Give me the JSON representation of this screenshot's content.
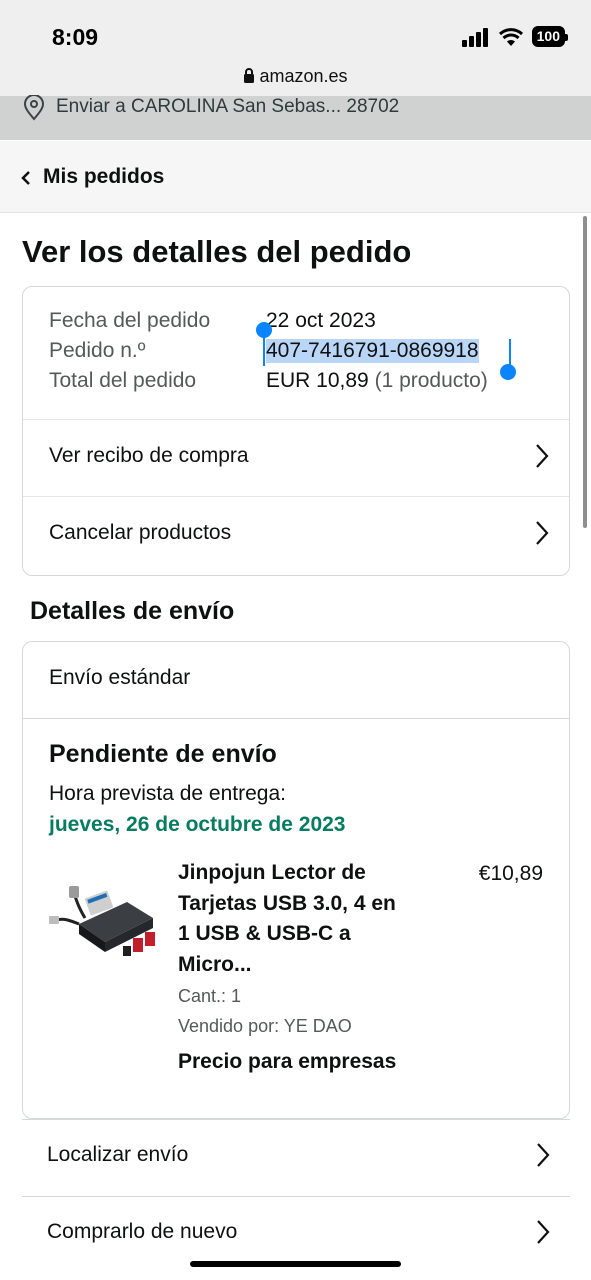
{
  "status": {
    "time": "8:09",
    "battery": "100"
  },
  "browser": {
    "url": "amazon.es"
  },
  "deliver": {
    "text": "Enviar a CAROLINA San Sebas... 28702"
  },
  "nav": {
    "back_label": "Mis pedidos"
  },
  "page": {
    "title": "Ver los detalles del pedido"
  },
  "order": {
    "date_label": "Fecha del pedido",
    "date_value": "22 oct 2023",
    "number_label": "Pedido n.º",
    "number_value": "407-7416791-0869918",
    "total_label": "Total del pedido",
    "total_value": "EUR 10,89",
    "total_count": "(1 producto)"
  },
  "actions": {
    "receipt": "Ver recibo de compra",
    "cancel": "Cancelar productos"
  },
  "shipping": {
    "heading": "Detalles de envío",
    "type": "Envío estándar",
    "status": "Pendiente de envío",
    "eta_label": "Hora prevista de entrega:",
    "eta_date": "jueves, 26 de octubre de 2023"
  },
  "product": {
    "title_lines": [
      "Jinpojun Lector de",
      "Tarjetas USB 3.0, 4 en",
      "1 USB & USB-C a",
      "Micro..."
    ],
    "price": "€10,89",
    "qty": "Cant.: 1",
    "seller": "Vendido por: YE DAO",
    "business_price": "Precio para empresas"
  },
  "bottom": {
    "track": "Localizar envío",
    "buy_again": "Comprarlo de nuevo"
  },
  "colors": {
    "accent_green": "#067d62",
    "selection": "#0a84ff",
    "highlight": "#b9d6f7"
  }
}
